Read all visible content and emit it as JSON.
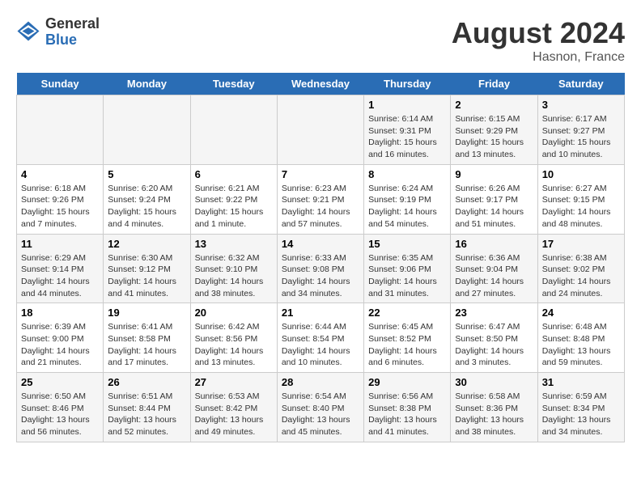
{
  "header": {
    "logo_general": "General",
    "logo_blue": "Blue",
    "main_title": "August 2024",
    "subtitle": "Hasnon, France"
  },
  "weekdays": [
    "Sunday",
    "Monday",
    "Tuesday",
    "Wednesday",
    "Thursday",
    "Friday",
    "Saturday"
  ],
  "weeks": [
    [
      {
        "day": "",
        "info": ""
      },
      {
        "day": "",
        "info": ""
      },
      {
        "day": "",
        "info": ""
      },
      {
        "day": "",
        "info": ""
      },
      {
        "day": "1",
        "info": "Sunrise: 6:14 AM\nSunset: 9:31 PM\nDaylight: 15 hours and 16 minutes."
      },
      {
        "day": "2",
        "info": "Sunrise: 6:15 AM\nSunset: 9:29 PM\nDaylight: 15 hours and 13 minutes."
      },
      {
        "day": "3",
        "info": "Sunrise: 6:17 AM\nSunset: 9:27 PM\nDaylight: 15 hours and 10 minutes."
      }
    ],
    [
      {
        "day": "4",
        "info": "Sunrise: 6:18 AM\nSunset: 9:26 PM\nDaylight: 15 hours and 7 minutes."
      },
      {
        "day": "5",
        "info": "Sunrise: 6:20 AM\nSunset: 9:24 PM\nDaylight: 15 hours and 4 minutes."
      },
      {
        "day": "6",
        "info": "Sunrise: 6:21 AM\nSunset: 9:22 PM\nDaylight: 15 hours and 1 minute."
      },
      {
        "day": "7",
        "info": "Sunrise: 6:23 AM\nSunset: 9:21 PM\nDaylight: 14 hours and 57 minutes."
      },
      {
        "day": "8",
        "info": "Sunrise: 6:24 AM\nSunset: 9:19 PM\nDaylight: 14 hours and 54 minutes."
      },
      {
        "day": "9",
        "info": "Sunrise: 6:26 AM\nSunset: 9:17 PM\nDaylight: 14 hours and 51 minutes."
      },
      {
        "day": "10",
        "info": "Sunrise: 6:27 AM\nSunset: 9:15 PM\nDaylight: 14 hours and 48 minutes."
      }
    ],
    [
      {
        "day": "11",
        "info": "Sunrise: 6:29 AM\nSunset: 9:14 PM\nDaylight: 14 hours and 44 minutes."
      },
      {
        "day": "12",
        "info": "Sunrise: 6:30 AM\nSunset: 9:12 PM\nDaylight: 14 hours and 41 minutes."
      },
      {
        "day": "13",
        "info": "Sunrise: 6:32 AM\nSunset: 9:10 PM\nDaylight: 14 hours and 38 minutes."
      },
      {
        "day": "14",
        "info": "Sunrise: 6:33 AM\nSunset: 9:08 PM\nDaylight: 14 hours and 34 minutes."
      },
      {
        "day": "15",
        "info": "Sunrise: 6:35 AM\nSunset: 9:06 PM\nDaylight: 14 hours and 31 minutes."
      },
      {
        "day": "16",
        "info": "Sunrise: 6:36 AM\nSunset: 9:04 PM\nDaylight: 14 hours and 27 minutes."
      },
      {
        "day": "17",
        "info": "Sunrise: 6:38 AM\nSunset: 9:02 PM\nDaylight: 14 hours and 24 minutes."
      }
    ],
    [
      {
        "day": "18",
        "info": "Sunrise: 6:39 AM\nSunset: 9:00 PM\nDaylight: 14 hours and 21 minutes."
      },
      {
        "day": "19",
        "info": "Sunrise: 6:41 AM\nSunset: 8:58 PM\nDaylight: 14 hours and 17 minutes."
      },
      {
        "day": "20",
        "info": "Sunrise: 6:42 AM\nSunset: 8:56 PM\nDaylight: 14 hours and 13 minutes."
      },
      {
        "day": "21",
        "info": "Sunrise: 6:44 AM\nSunset: 8:54 PM\nDaylight: 14 hours and 10 minutes."
      },
      {
        "day": "22",
        "info": "Sunrise: 6:45 AM\nSunset: 8:52 PM\nDaylight: 14 hours and 6 minutes."
      },
      {
        "day": "23",
        "info": "Sunrise: 6:47 AM\nSunset: 8:50 PM\nDaylight: 14 hours and 3 minutes."
      },
      {
        "day": "24",
        "info": "Sunrise: 6:48 AM\nSunset: 8:48 PM\nDaylight: 13 hours and 59 minutes."
      }
    ],
    [
      {
        "day": "25",
        "info": "Sunrise: 6:50 AM\nSunset: 8:46 PM\nDaylight: 13 hours and 56 minutes."
      },
      {
        "day": "26",
        "info": "Sunrise: 6:51 AM\nSunset: 8:44 PM\nDaylight: 13 hours and 52 minutes."
      },
      {
        "day": "27",
        "info": "Sunrise: 6:53 AM\nSunset: 8:42 PM\nDaylight: 13 hours and 49 minutes."
      },
      {
        "day": "28",
        "info": "Sunrise: 6:54 AM\nSunset: 8:40 PM\nDaylight: 13 hours and 45 minutes."
      },
      {
        "day": "29",
        "info": "Sunrise: 6:56 AM\nSunset: 8:38 PM\nDaylight: 13 hours and 41 minutes."
      },
      {
        "day": "30",
        "info": "Sunrise: 6:58 AM\nSunset: 8:36 PM\nDaylight: 13 hours and 38 minutes."
      },
      {
        "day": "31",
        "info": "Sunrise: 6:59 AM\nSunset: 8:34 PM\nDaylight: 13 hours and 34 minutes."
      }
    ]
  ]
}
